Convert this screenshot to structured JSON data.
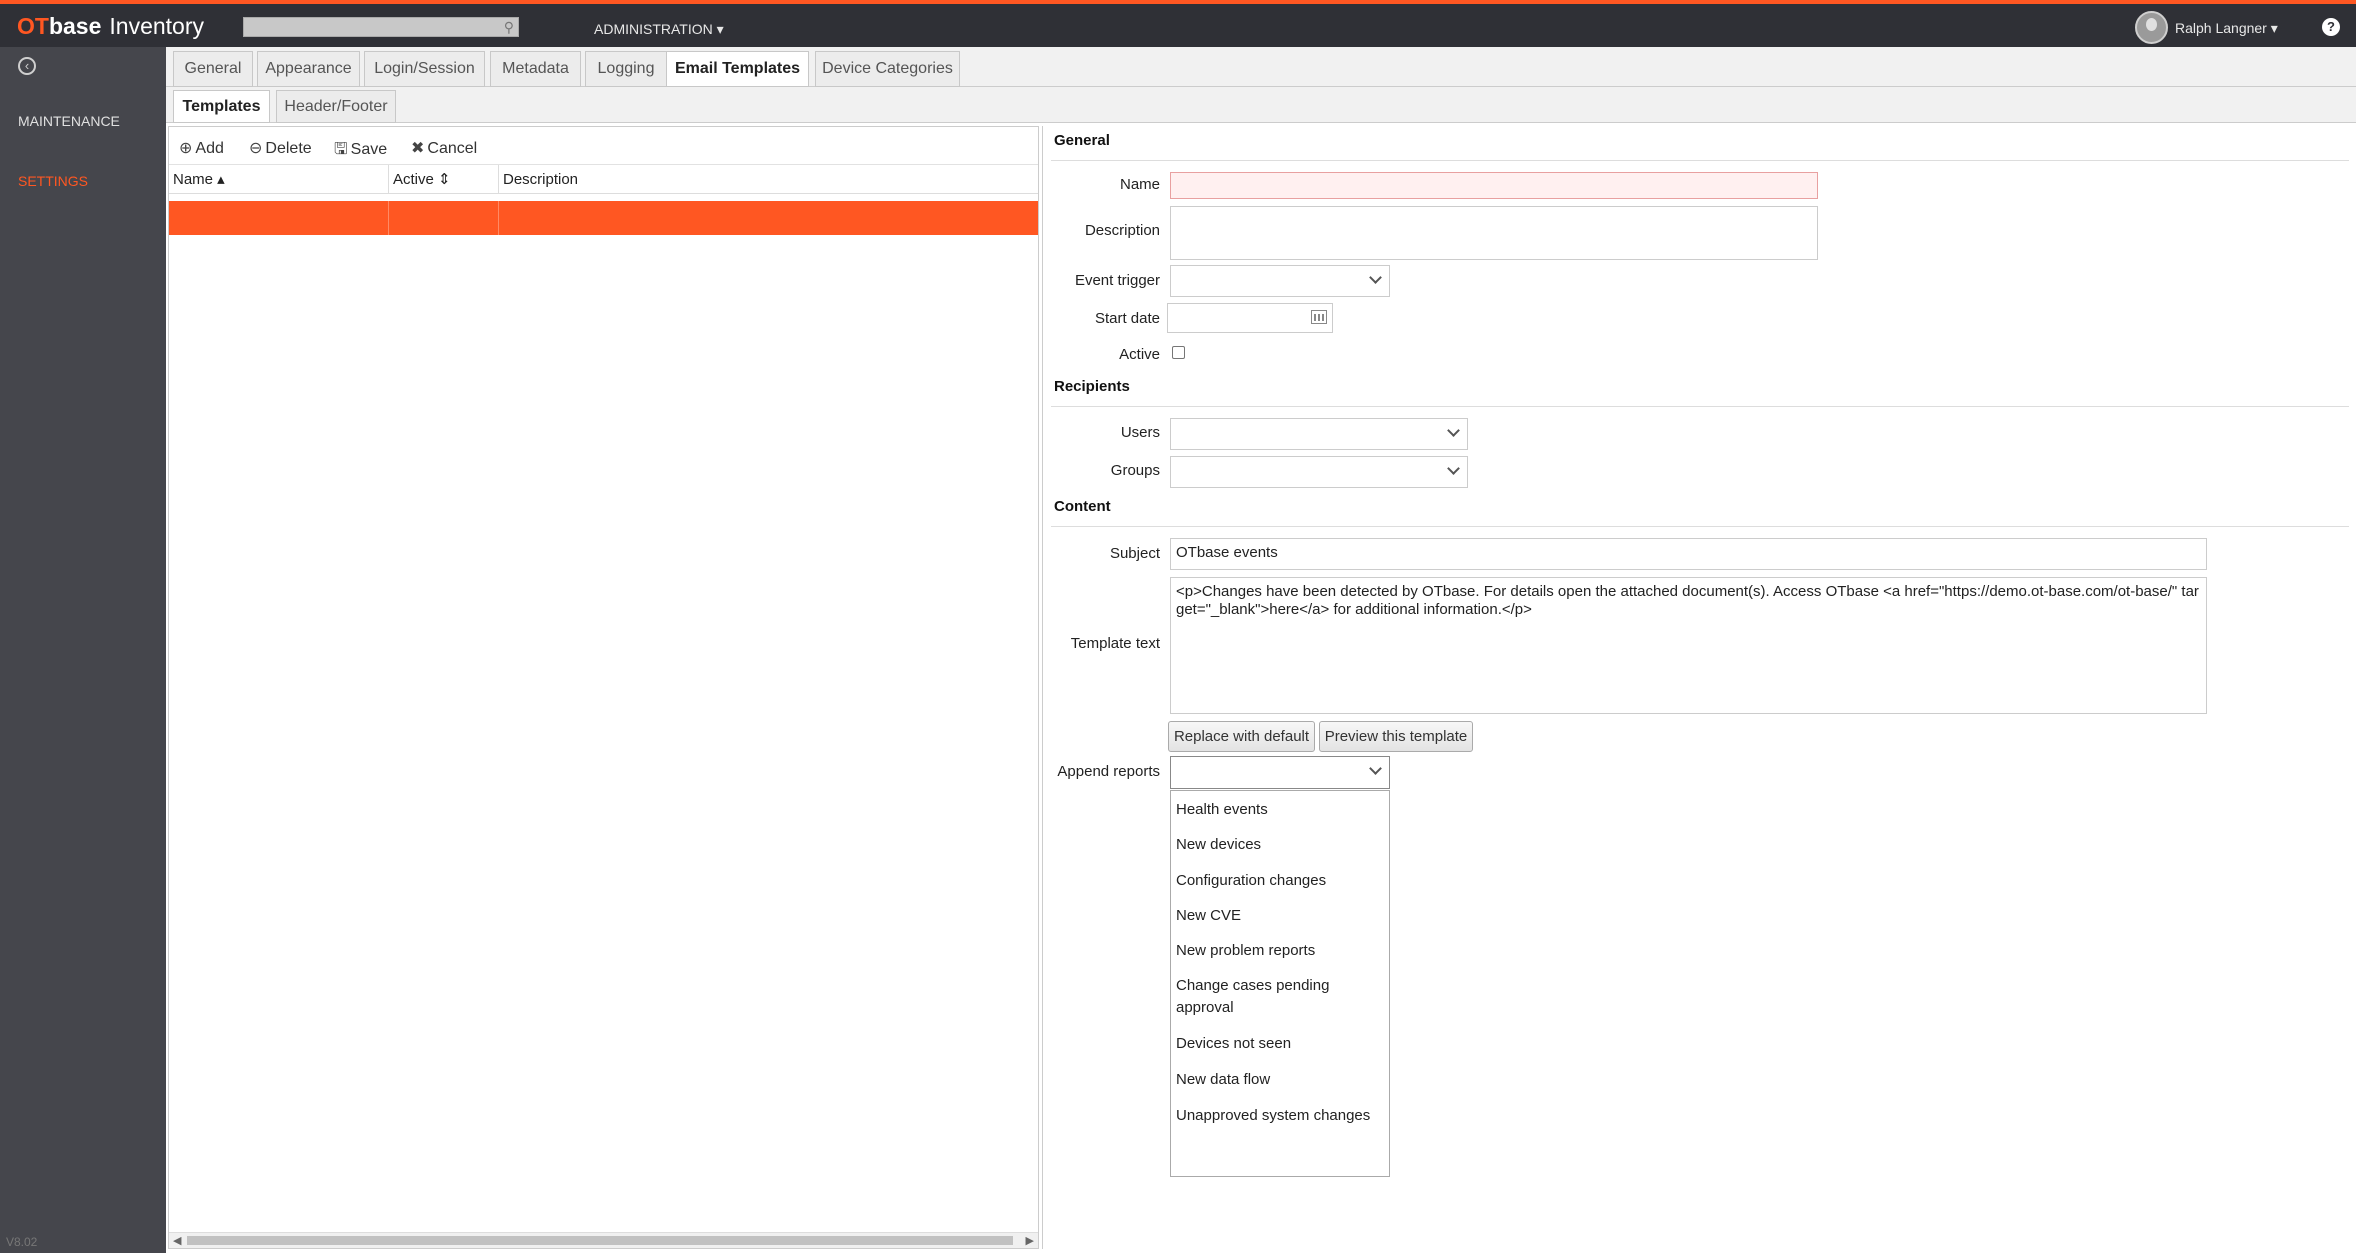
{
  "header": {
    "logo_ot": "OT",
    "logo_base": "base",
    "logo_product": "Inventory",
    "admin_menu": "ADMINISTRATION ▾",
    "user_name": "Ralph Langner ▾",
    "help": "?"
  },
  "sidebar": {
    "items": [
      {
        "label": "MAINTENANCE"
      },
      {
        "label": "SETTINGS"
      }
    ],
    "version": "V8.02"
  },
  "tabs": [
    {
      "label": "General"
    },
    {
      "label": "Appearance"
    },
    {
      "label": "Login/Session"
    },
    {
      "label": "Metadata"
    },
    {
      "label": "Logging"
    },
    {
      "label": "Email Templates"
    },
    {
      "label": "Device Categories"
    }
  ],
  "subtabs": [
    {
      "label": "Templates"
    },
    {
      "label": "Header/Footer"
    }
  ],
  "toolbar": {
    "add": "Add",
    "delete": "Delete",
    "save": "Save",
    "cancel": "Cancel"
  },
  "grid": {
    "columns": [
      {
        "label": "Name ▴"
      },
      {
        "label": "Active ⇕"
      },
      {
        "label": "Description"
      }
    ]
  },
  "form": {
    "general_title": "General",
    "name_label": "Name",
    "description_label": "Description",
    "event_trigger_label": "Event trigger",
    "start_date_label": "Start date",
    "active_label": "Active",
    "recipients_title": "Recipients",
    "users_label": "Users",
    "groups_label": "Groups",
    "content_title": "Content",
    "subject_label": "Subject",
    "subject_value": "OTbase events",
    "template_text_label": "Template text",
    "template_text_value": "<p>Changes have been detected by OTbase. For details open the attached document(s). Access OTbase <a href=\"https://demo.ot-base.com/ot-base/\" target=\"_blank\">here</a> for additional information.</p>",
    "replace_default_button": "Replace with default",
    "preview_button": "Preview this template",
    "append_reports_label": "Append reports"
  },
  "append_reports_options": [
    {
      "label": "Health events"
    },
    {
      "label": "New devices"
    },
    {
      "label": "Configuration changes"
    },
    {
      "label": "New CVE"
    },
    {
      "label": "New problem reports"
    },
    {
      "label": "Change cases pending approval"
    },
    {
      "label": "Devices not seen"
    },
    {
      "label": "New data flow"
    },
    {
      "label": "Unapproved system changes"
    }
  ],
  "colors": {
    "accent": "#ff5722",
    "topbar": "#2f3036",
    "sidebar": "#45464c"
  }
}
